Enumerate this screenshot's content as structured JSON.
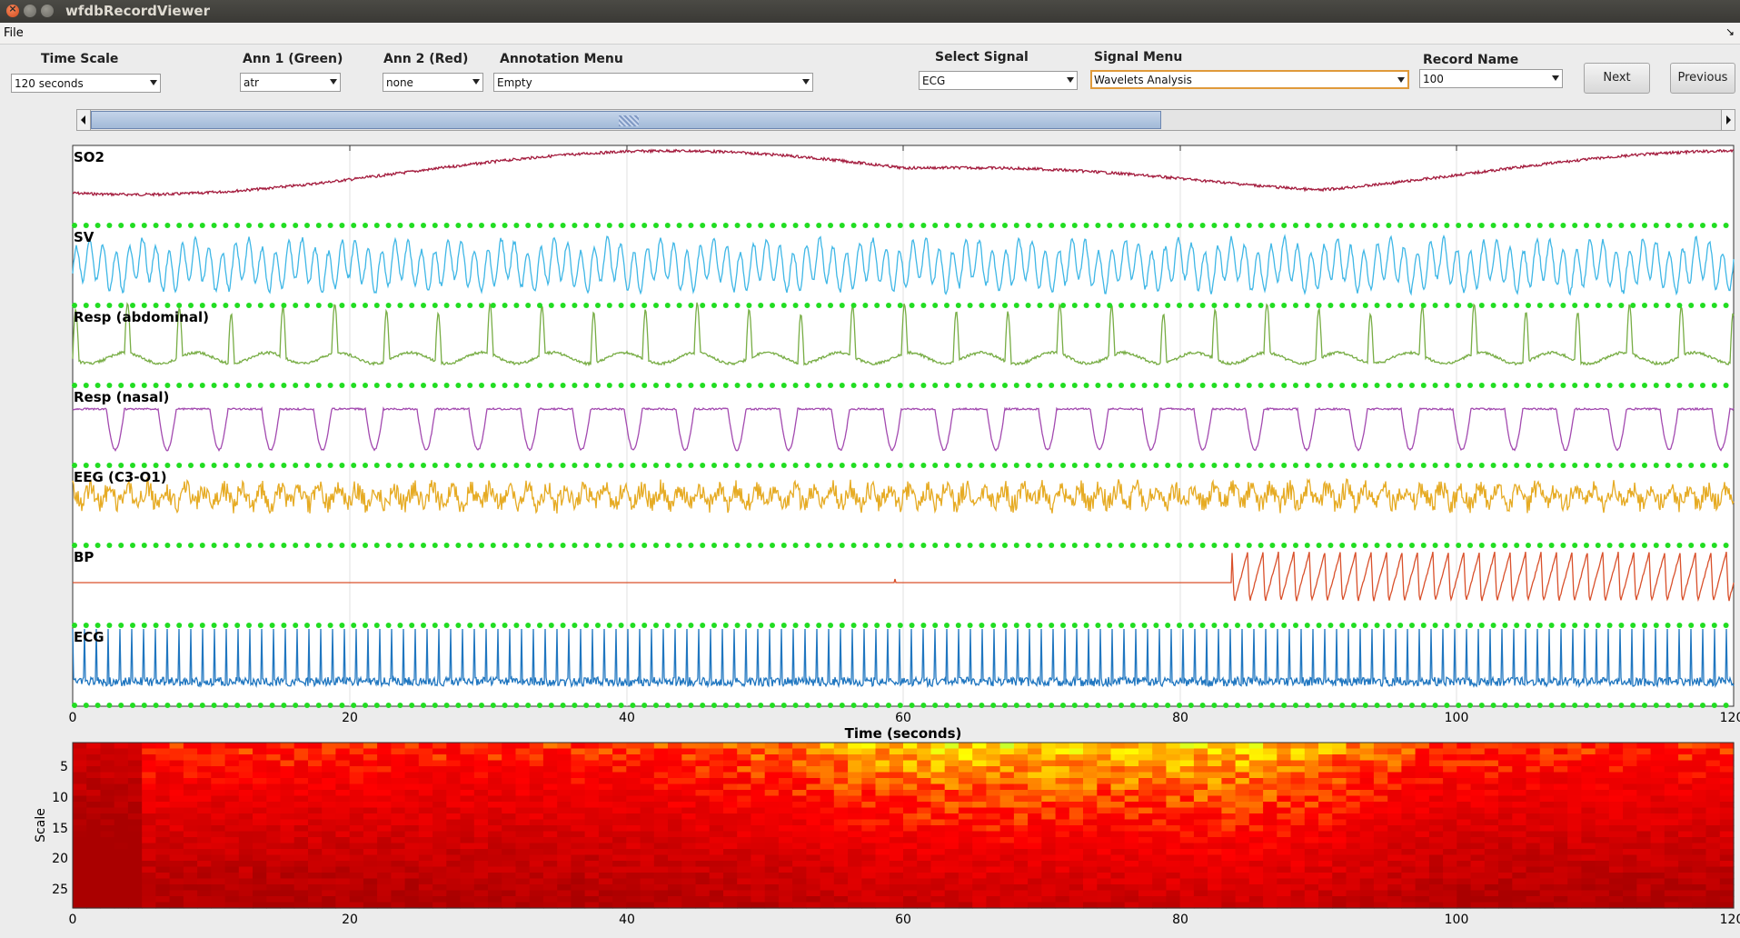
{
  "window": {
    "title": "wfdbRecordViewer"
  },
  "menubar": {
    "file": "File",
    "collapse": "↘"
  },
  "toolbar": {
    "time_scale": {
      "label": "Time Scale",
      "value": "120 seconds"
    },
    "ann1": {
      "label": "Ann 1 (Green)",
      "value": "atr"
    },
    "ann2": {
      "label": "Ann 2 (Red)",
      "value": "none"
    },
    "annotation_menu": {
      "label": "Annotation Menu",
      "value": "Empty"
    },
    "select_signal": {
      "label": "Select Signal",
      "value": "ECG"
    },
    "signal_menu": {
      "label": "Signal Menu",
      "value": "Wavelets Analysis"
    },
    "record_name": {
      "label": "Record Name",
      "value": "100"
    },
    "next": "Next",
    "previous": "Previous"
  },
  "signals_plot": {
    "channels": [
      {
        "name": "SO2",
        "color": "#a31a3c"
      },
      {
        "name": "SV",
        "color": "#3fb7e6"
      },
      {
        "name": "Resp (abdominal)",
        "color": "#78ad45"
      },
      {
        "name": "Resp (nasal)",
        "color": "#a34ab0"
      },
      {
        "name": "EEG (C3-O1)",
        "color": "#e6ab24"
      },
      {
        "name": "BP",
        "color": "#d9502b"
      },
      {
        "name": "ECG",
        "color": "#1f76c0"
      }
    ],
    "annotation_color": "#22dd22",
    "xlabel": "Time (seconds)",
    "xticks": [
      "0",
      "20",
      "40",
      "60",
      "80",
      "100",
      "120"
    ]
  },
  "wavelet_plot": {
    "ylabel": "Scale",
    "yticks": [
      "5",
      "10",
      "15",
      "20",
      "25"
    ],
    "xticks": [
      "0",
      "20",
      "40",
      "60",
      "80",
      "100",
      "120"
    ],
    "colormap": "hot"
  }
}
